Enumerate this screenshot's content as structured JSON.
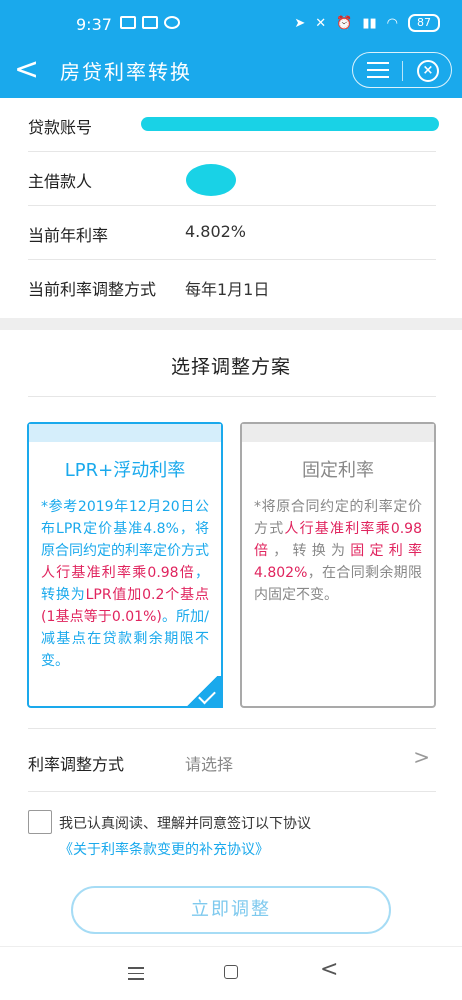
{
  "status_bar": {
    "time": "9:37",
    "battery": "87"
  },
  "app_bar": {
    "back": "<",
    "title": "房贷利率转换",
    "close": "×"
  },
  "info": {
    "loan_account_label": "贷款账号",
    "borrower_label": "主借款人",
    "rate_label": "当前年利率",
    "rate_value": "4.802%",
    "method_label": "当前利率调整方式",
    "method_value": "每年1月1日"
  },
  "section_title": "选择调整方案",
  "plans": {
    "lpr": {
      "title": "LPR+浮动利率",
      "text1": "*参考2019年12月20日公布LPR定价基准4.8%，将原合同约定的利率定价方式",
      "hl1": "人行基准利率乘0.98倍",
      "text2": "，转换为",
      "hl2": "LPR值加0.2个基点(1基点等于0.01%)",
      "text3": "。所加/减基点在贷款剩余期限不变。"
    },
    "fixed": {
      "title": "固定利率",
      "text1": "*将原合同约定的利率定价方式",
      "hl1": "人行基准利率乘0.98倍",
      "text2": "，转换为",
      "hl2": "固定利率4.802%",
      "text3": "，在合同剩余期限内固定不变。"
    }
  },
  "select_row": {
    "label": "利率调整方式",
    "placeholder": "请选择",
    "chevron": ">"
  },
  "agreement": {
    "text": "我已认真阅读、理解并同意签订以下协议",
    "link": "《关于利率条款变更的补充协议》"
  },
  "submit": "立即调整",
  "nav": {
    "back": "<"
  }
}
